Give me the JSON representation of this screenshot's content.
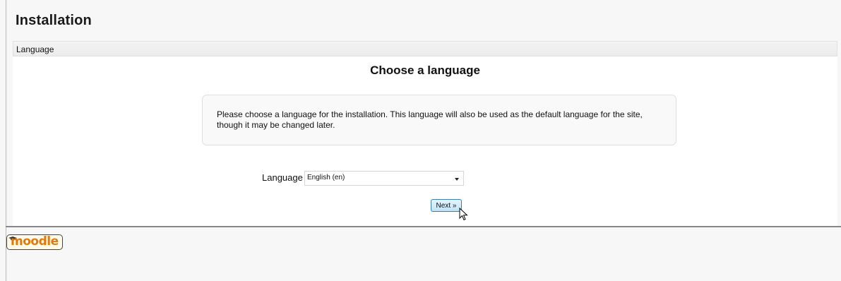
{
  "header": {
    "title": "Installation"
  },
  "breadcrumb": {
    "label": "Language"
  },
  "main": {
    "heading": "Choose a language",
    "info_text": "Please choose a language for the installation. This language will also be used as the default language for the site, though it may be changed later.",
    "language_label": "Language",
    "language_select": {
      "selected": "English (en)"
    },
    "next_button_label": "Next »"
  },
  "footer": {
    "logo_text": "moodle"
  },
  "colors": {
    "accent": "#3c7fb1",
    "logo": "#e07a10",
    "page_bg": "#f7f7f7"
  }
}
